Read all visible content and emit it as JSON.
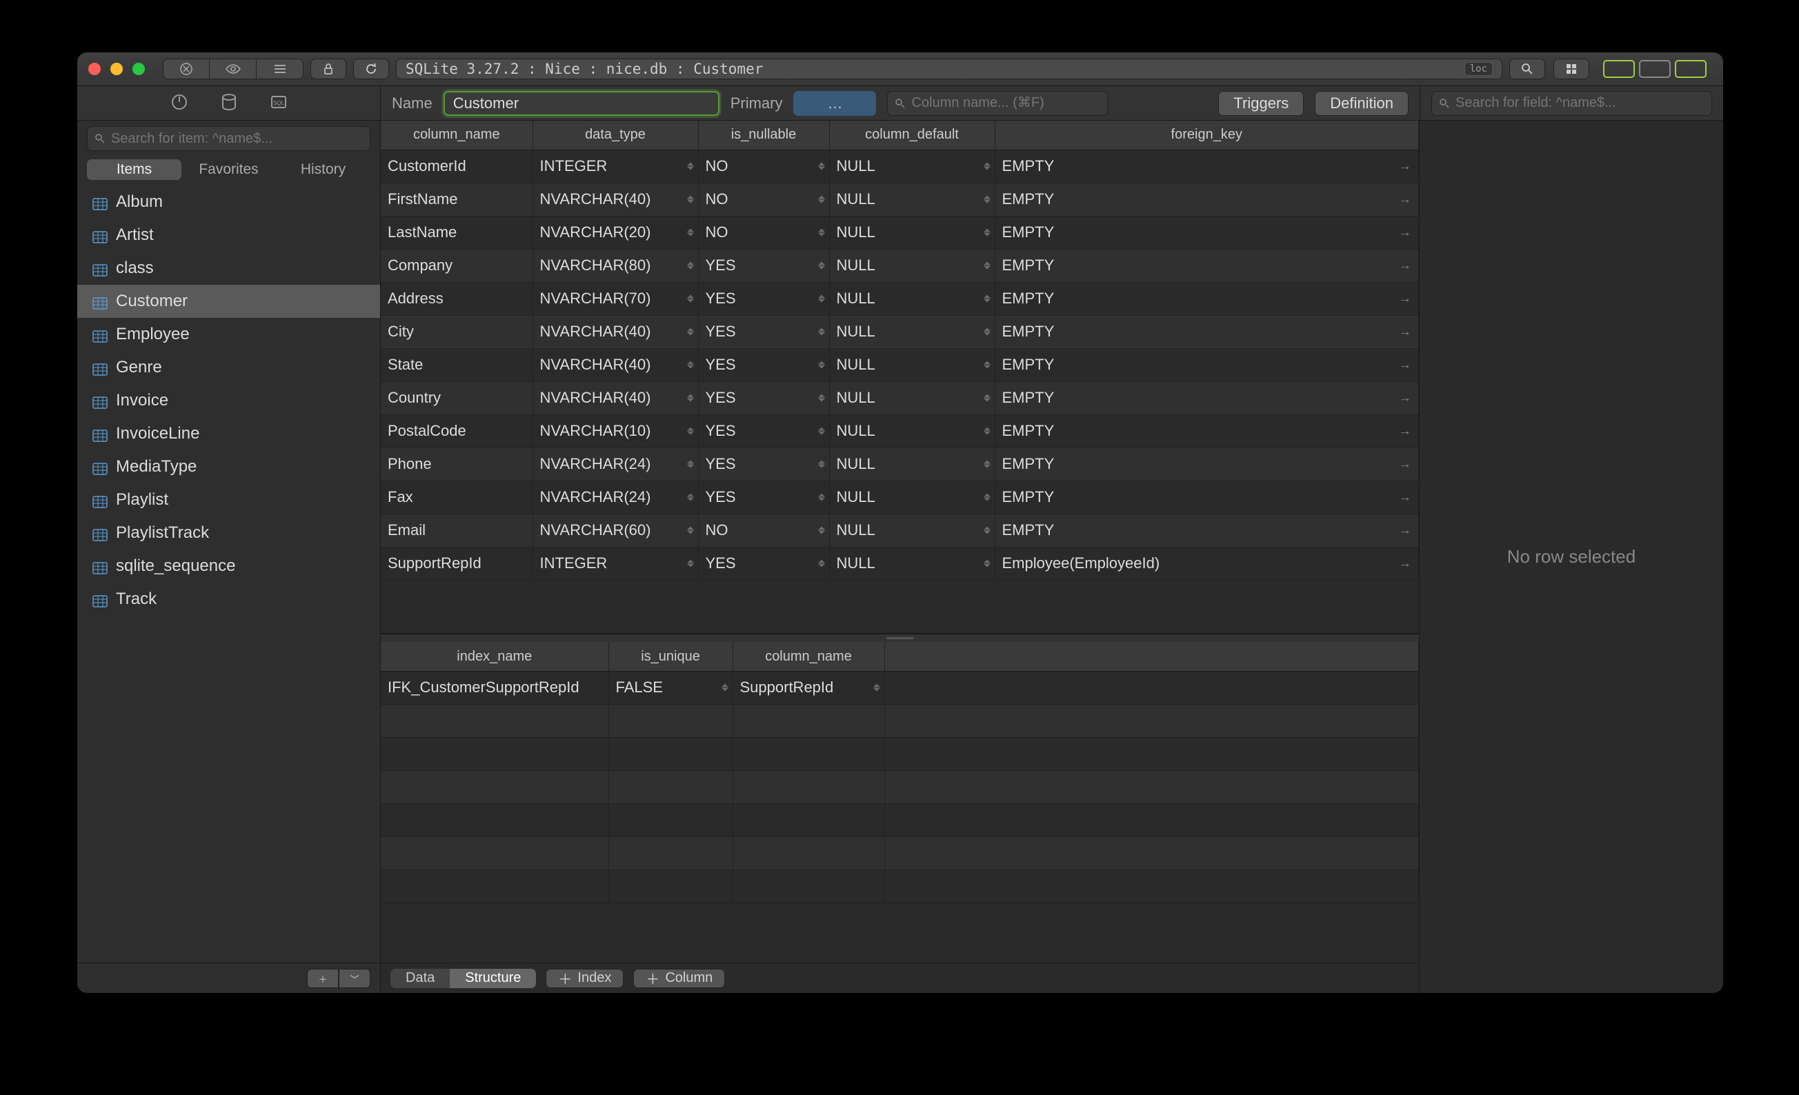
{
  "titlebar": {
    "breadcrumb": "SQLite 3.27.2 : Nice : nice.db : Customer",
    "loc": "loc"
  },
  "subtoolbar": {
    "name_label": "Name",
    "name_value": "Customer",
    "primary_label": "Primary",
    "primary_value": "…",
    "col_search_placeholder": "Column name... (⌘F)",
    "triggers": "Triggers",
    "definition": "Definition",
    "field_search_placeholder": "Search for field: ^name$..."
  },
  "sidebar": {
    "search_placeholder": "Search for item: ^name$...",
    "tabs": {
      "items": "Items",
      "favorites": "Favorites",
      "history": "History"
    },
    "tables": [
      {
        "name": "Album"
      },
      {
        "name": "Artist"
      },
      {
        "name": "class"
      },
      {
        "name": "Customer",
        "selected": true
      },
      {
        "name": "Employee"
      },
      {
        "name": "Genre"
      },
      {
        "name": "Invoice"
      },
      {
        "name": "InvoiceLine"
      },
      {
        "name": "MediaType"
      },
      {
        "name": "Playlist"
      },
      {
        "name": "PlaylistTrack"
      },
      {
        "name": "sqlite_sequence"
      },
      {
        "name": "Track"
      }
    ]
  },
  "columns_table": {
    "headers": {
      "column_name": "column_name",
      "data_type": "data_type",
      "is_nullable": "is_nullable",
      "column_default": "column_default",
      "foreign_key": "foreign_key"
    },
    "rows": [
      {
        "name": "CustomerId",
        "type": "INTEGER",
        "nullable": "NO",
        "default": "NULL",
        "fk": "EMPTY"
      },
      {
        "name": "FirstName",
        "type": "NVARCHAR(40)",
        "nullable": "NO",
        "default": "NULL",
        "fk": "EMPTY"
      },
      {
        "name": "LastName",
        "type": "NVARCHAR(20)",
        "nullable": "NO",
        "default": "NULL",
        "fk": "EMPTY"
      },
      {
        "name": "Company",
        "type": "NVARCHAR(80)",
        "nullable": "YES",
        "default": "NULL",
        "fk": "EMPTY"
      },
      {
        "name": "Address",
        "type": "NVARCHAR(70)",
        "nullable": "YES",
        "default": "NULL",
        "fk": "EMPTY"
      },
      {
        "name": "City",
        "type": "NVARCHAR(40)",
        "nullable": "YES",
        "default": "NULL",
        "fk": "EMPTY"
      },
      {
        "name": "State",
        "type": "NVARCHAR(40)",
        "nullable": "YES",
        "default": "NULL",
        "fk": "EMPTY"
      },
      {
        "name": "Country",
        "type": "NVARCHAR(40)",
        "nullable": "YES",
        "default": "NULL",
        "fk": "EMPTY"
      },
      {
        "name": "PostalCode",
        "type": "NVARCHAR(10)",
        "nullable": "YES",
        "default": "NULL",
        "fk": "EMPTY"
      },
      {
        "name": "Phone",
        "type": "NVARCHAR(24)",
        "nullable": "YES",
        "default": "NULL",
        "fk": "EMPTY"
      },
      {
        "name": "Fax",
        "type": "NVARCHAR(24)",
        "nullable": "YES",
        "default": "NULL",
        "fk": "EMPTY"
      },
      {
        "name": "Email",
        "type": "NVARCHAR(60)",
        "nullable": "NO",
        "default": "NULL",
        "fk": "EMPTY"
      },
      {
        "name": "SupportRepId",
        "type": "INTEGER",
        "nullable": "YES",
        "default": "NULL",
        "fk": "Employee(EmployeeId)"
      }
    ]
  },
  "indexes_table": {
    "headers": {
      "index_name": "index_name",
      "is_unique": "is_unique",
      "column_name": "column_name"
    },
    "rows": [
      {
        "name": "IFK_CustomerSupportRepId",
        "unique": "FALSE",
        "column": "SupportRepId"
      }
    ]
  },
  "main_footer": {
    "data": "Data",
    "structure": "Structure",
    "index": "Index",
    "column": "Column"
  },
  "detail": {
    "empty": "No row selected"
  }
}
